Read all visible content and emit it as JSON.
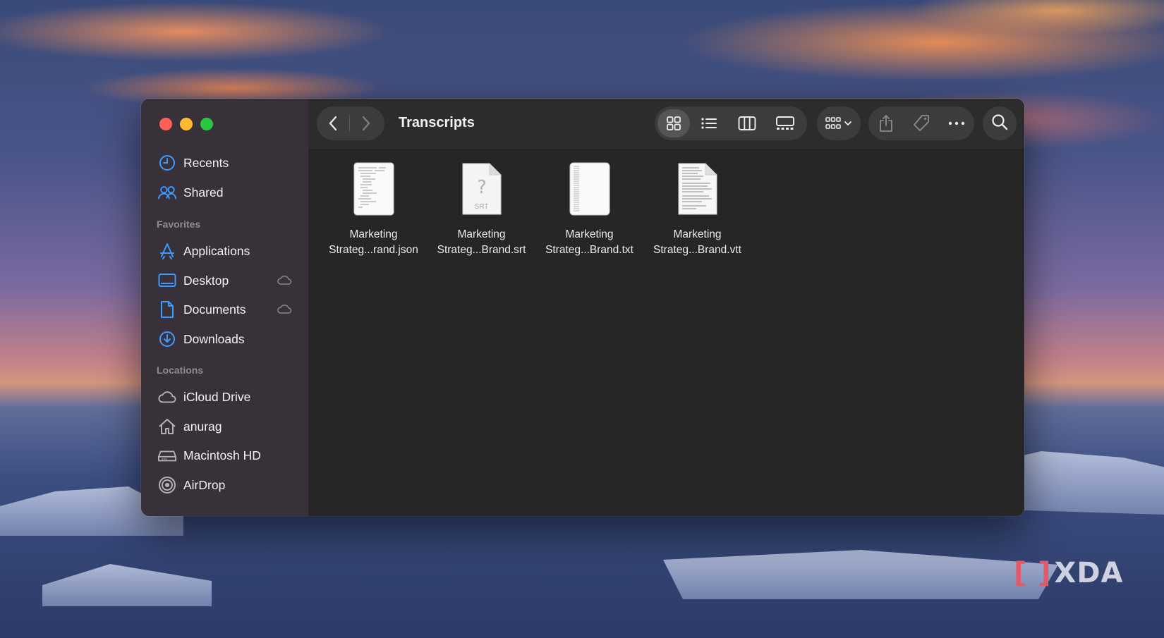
{
  "window": {
    "title": "Transcripts"
  },
  "sidebar": {
    "top_items": [
      {
        "label": "Recents",
        "icon": "clock-icon"
      },
      {
        "label": "Shared",
        "icon": "people-icon"
      }
    ],
    "favorites_header": "Favorites",
    "favorites": [
      {
        "label": "Applications",
        "icon": "applications-icon"
      },
      {
        "label": "Desktop",
        "icon": "desktop-icon",
        "cloud": true
      },
      {
        "label": "Documents",
        "icon": "document-icon",
        "cloud": true
      },
      {
        "label": "Downloads",
        "icon": "download-icon"
      }
    ],
    "locations_header": "Locations",
    "locations": [
      {
        "label": "iCloud Drive",
        "icon": "cloud-icon"
      },
      {
        "label": "anurag",
        "icon": "home-icon"
      },
      {
        "label": "Macintosh HD",
        "icon": "disk-icon"
      },
      {
        "label": "AirDrop",
        "icon": "airdrop-icon"
      }
    ]
  },
  "toolbar": {
    "view_modes": [
      "icon-view",
      "list-view",
      "column-view",
      "gallery-view"
    ],
    "active_view": "icon-view",
    "group_label": "group-by-icon",
    "actions": [
      "share-icon",
      "tag-icon",
      "more-icon"
    ],
    "search": "search-icon"
  },
  "files": [
    {
      "line1": "Marketing",
      "line2": "Strateg...rand.json",
      "type": "json"
    },
    {
      "line1": "Marketing",
      "line2": "Strateg...Brand.srt",
      "type": "srt",
      "badge": "SRT"
    },
    {
      "line1": "Marketing",
      "line2": "Strateg...Brand.txt",
      "type": "txt"
    },
    {
      "line1": "Marketing",
      "line2": "Strateg...Brand.vtt",
      "type": "vtt"
    }
  ],
  "colors": {
    "accent": "#3d9bff",
    "close": "#ff5f57",
    "minimize": "#febc2e",
    "zoom": "#28c840"
  },
  "watermark": "XDA"
}
